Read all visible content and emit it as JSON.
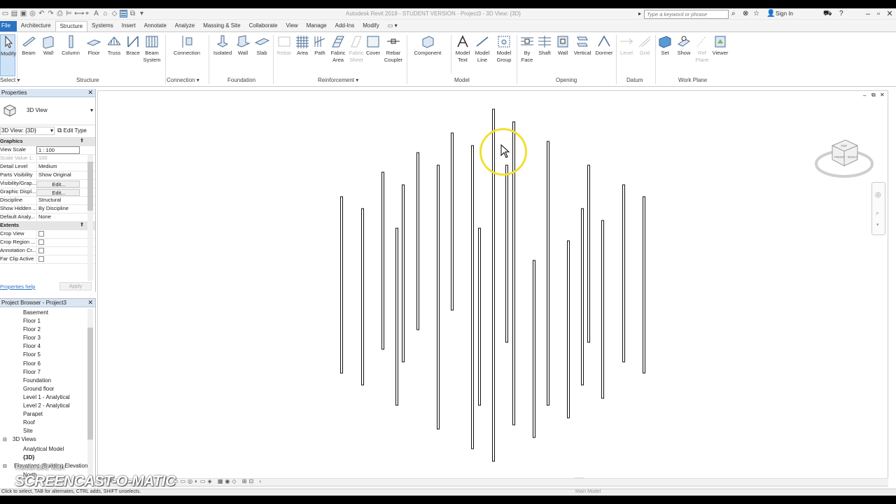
{
  "title_bar": {
    "app_title": "Autodesk Revit 2018 - STUDENT VERSION - Project3 - 3D View: {3D}",
    "search_placeholder": "Type a keyword or phrase",
    "sign_in": "Sign In"
  },
  "ribbon_tabs": [
    "File",
    "Architecture",
    "Structure",
    "Systems",
    "Insert",
    "Annotate",
    "Analyze",
    "Massing & Site",
    "Collaborate",
    "View",
    "Manage",
    "Add-Ins",
    "Modify"
  ],
  "ribbon": {
    "modify_label": "Modify",
    "select_label": "Select",
    "structure": [
      "Beam",
      "Wall",
      "Column",
      "Floor",
      "Truss",
      "Brace",
      "Beam System"
    ],
    "connection": [
      "Connection"
    ],
    "foundation": [
      "Isolated",
      "Wall",
      "Slab"
    ],
    "reinforcement": [
      "Rebar",
      "Area",
      "Path",
      "Fabric Area",
      "Fabric Sheet",
      "Cover",
      "Rebar Coupler"
    ],
    "model": [
      "Component",
      "Model Text",
      "Model Line",
      "Model Group"
    ],
    "opening": [
      "By Face",
      "Shaft",
      "Wall",
      "Vertical",
      "Dormer"
    ],
    "datum": [
      "Level",
      "Grid"
    ],
    "work_plane": [
      "Set",
      "Show",
      "Ref Plane",
      "Viewer"
    ],
    "panels": {
      "structure": "Structure",
      "connection": "Connection",
      "foundation": "Foundation",
      "reinforcement": "Reinforcement",
      "model": "Model",
      "opening": "Opening",
      "datum": "Datum",
      "work_plane": "Work Plane"
    }
  },
  "properties": {
    "header": "Properties",
    "type_name": "3D View",
    "filter": "3D View: {3D}",
    "edit_type": "Edit Type",
    "sections": {
      "graphics": "Graphics",
      "extents": "Extents"
    },
    "rows": [
      {
        "key": "View Scale",
        "value": "1 : 100"
      },
      {
        "key": "Scale Value 1:",
        "value": "100"
      },
      {
        "key": "Detail Level",
        "value": "Medium"
      },
      {
        "key": "Parts Visibility",
        "value": "Show Original"
      },
      {
        "key": "Visibility/Grap...",
        "value": "Edit..."
      },
      {
        "key": "Graphic Displ...",
        "value": "Edit..."
      },
      {
        "key": "Discipline",
        "value": "Structural"
      },
      {
        "key": "Show Hidden ...",
        "value": "By Discipline"
      },
      {
        "key": "Default Analy...",
        "value": "None"
      }
    ],
    "extent_rows": [
      "Crop View",
      "Crop Region ...",
      "Annotation Cr...",
      "Far Clip Active"
    ],
    "help_link": "Properties help",
    "apply": "Apply"
  },
  "project_browser": {
    "header": "Project Browser - Project3",
    "items": [
      {
        "label": "Basement",
        "level": 2
      },
      {
        "label": "Floor 1",
        "level": 2
      },
      {
        "label": "Floor 2",
        "level": 2
      },
      {
        "label": "Floor 3",
        "level": 2
      },
      {
        "label": "Floor 4",
        "level": 2
      },
      {
        "label": "Floor 5",
        "level": 2
      },
      {
        "label": "Floor 6",
        "level": 2
      },
      {
        "label": "Floor 7",
        "level": 2
      },
      {
        "label": "Foundation",
        "level": 2
      },
      {
        "label": "Ground floor",
        "level": 2
      },
      {
        "label": "Level 1 - Analytical",
        "level": 2
      },
      {
        "label": "Level 2 - Analytical",
        "level": 2
      },
      {
        "label": "Parapet",
        "level": 2
      },
      {
        "label": "Roof",
        "level": 2
      },
      {
        "label": "Site",
        "level": 2
      },
      {
        "label": "3D Views",
        "level": 1
      },
      {
        "label": "Analytical Model",
        "level": 2
      },
      {
        "label": "{3D}",
        "level": 2
      },
      {
        "label": "Elevations (Building Elevation)",
        "level": 1
      },
      {
        "label": "North",
        "level": 2
      }
    ]
  },
  "view": {
    "scale_label": "1 : 100",
    "model_label": "Main Model"
  },
  "status_bar": {
    "text": "Click to select, TAB for alternates, CTRL adds, SHIFT unselects."
  },
  "watermark": {
    "recorded": "Recorded with",
    "brand": "SCREENCAST-O-MATIC"
  },
  "colors": {
    "accent": "#2a72c2",
    "cursor_highlight": "#f2e033"
  }
}
